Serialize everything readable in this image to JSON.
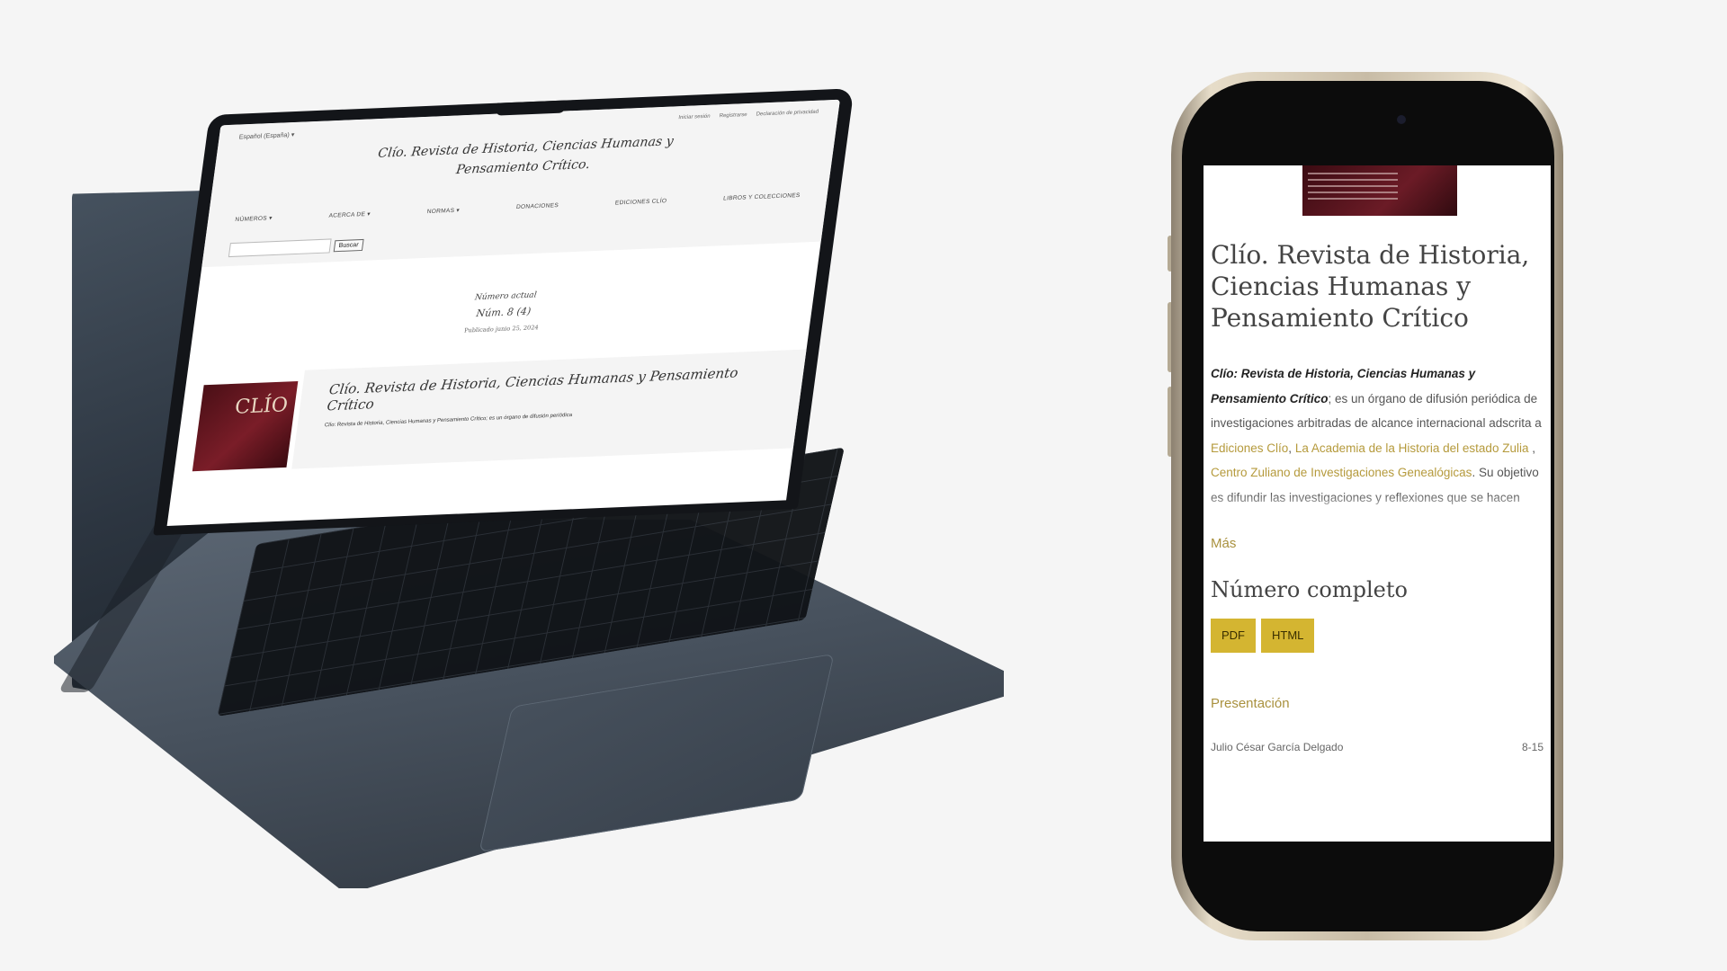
{
  "laptop": {
    "language": "Español (España) ▾",
    "user_links": [
      "Iniciar sesión",
      "Registrarse",
      "Declaración de privacidad"
    ],
    "site_title": "Clío. Revista de Historia, Ciencias Humanas y Pensamiento Crítico.",
    "nav": [
      "NÚMEROS ▾",
      "ACERCA DE ▾",
      "NORMAS ▾",
      "DONACIONES",
      "EDICIONES CLÍO",
      "LIBROS Y COLECCIONES"
    ],
    "search_button": "Buscar",
    "current_issue_label": "Número actual",
    "issue_number": "Núm. 8 (4)",
    "published": "Publicado junio 25, 2024",
    "card_title": "Clío. Revista de Historia, Ciencias Humanas y Pensamiento Crítico",
    "card_text": "Clío: Revista de Historia, Ciencias Humanas y Pensamiento Crítico; es un órgano de difusión periódica",
    "cover_text": "CLÍO"
  },
  "phone": {
    "title": "Clío. Revista de Historia, Ciencias Humanas y Pensamiento Crítico",
    "desc_bold": "Clío: Revista de Historia, Ciencias Humanas y Pensamiento Crítico",
    "desc_1": "; es un órgano de difusión periódica de investigaciones arbitradas de alcance internacional adscrita a ",
    "link_1": "Ediciones Clío",
    "sep_1": ", ",
    "link_2": "La Academia de la Historia del estado Zulia",
    "sep_2": " ,  ",
    "link_3": "Centro Zuliano de Investigaciones Genealógicas",
    "desc_2": ". Su objetivo es difundir las investigaciones y reflexiones que se hacen desde las  Ciencias Humanas abordando problemáticas sociales desde distintas áreas del estudio como la Filosofía, Historia, Educación, Ciencias Políticas, Antropología, Sociología",
    "more": "Más",
    "full_issue": "Número completo",
    "btn_pdf": "PDF",
    "btn_html": "HTML",
    "section": "Presentación",
    "author": "Julio César García Delgado",
    "pages": "8-15"
  }
}
